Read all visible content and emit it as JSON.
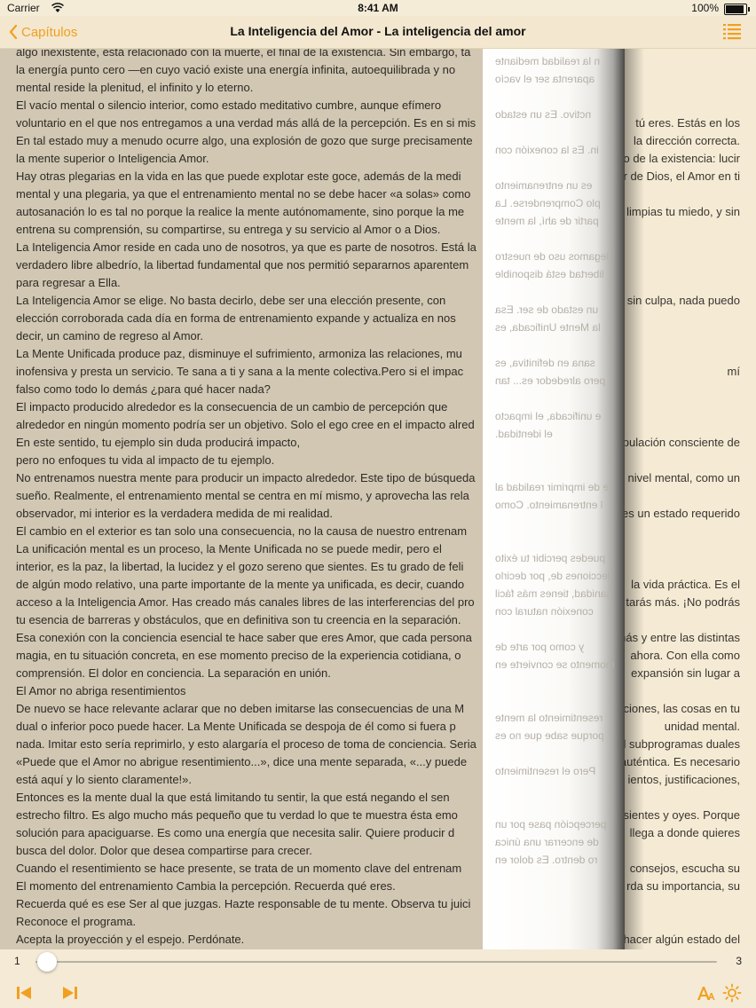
{
  "status_bar": {
    "carrier": "Carrier",
    "time": "8:41 AM",
    "battery": "100%"
  },
  "navbar": {
    "back_label": "Capítulos",
    "title": "La Inteligencia del Amor - La inteligencia del amor"
  },
  "paragraphs": [
    "algo inexistente, está relacionado con la muerte, el final de la existencia. Sin embargo, tan solo se trata de una falta de realidad mediante la energía punto cero —en cuyo vació existe una energía infinita, autoequilibrada y no ... aparenta ser el vacío mental reside la plenitud, el infinito y lo eterno.",
    "El vacío mental o silencio interior, como estado meditativo cumbre, aunque efímero, es ... Es un estado voluntario en el que nos entregamos a una verdad más allá de la percepción. Es en si mismo ... tú eres. Estás en los",
    "En tal estado muy a menudo ocurre algo, una explosión de gozo que surge precisamente ... Es la conexión con la dirección correcta.",
    "la mente superior o Inteligencia Amor. ... lo de la existencia: lucir",
    "Hay otras plegarias en la vida en las que puede explotar este goce, además de la medi... es un entrenamiento ... r de Dios, el Amor en ti mental y una plegaria, ya que el entrenamiento mental no se debe hacer «a solas» como ... La autosanación lo es tal no porque la realice la mente autónomamente, sino porque la me... limpias tu miedo, y sin entrena su comprensión, su compartirse, su entrega y su servicio al Amor o a Dios.",
    "La Inteligencia Amor reside en cada uno de nosotros, ya que es parte de nosotros. Está la ... verdadero libre albedrío, la libertad fundamental que nos permitió separarnos aparentem... para regresar a Ella.",
    "La Inteligencia Amor se elige. No basta decirlo, debe ser una elección presente, con... sin culpa, nada puedo elección corroborada cada día en forma de entrenamiento expande y actualiza en nos... decir, un camino de regreso al Amor.",
    "La Mente Unificada produce paz, disminuye el sufrimiento, armoniza las relaciones, mu... inofensiva y presta un servicio. Te sana a ti y sana a la mente colectiva.Pero si el impac... mí falso como todo lo demás ¿para qué hacer nada?",
    "El impacto producido alrededor es la consecuencia de un cambio de percepción que ... alrededor en ningún momento podría ser un objetivo. Solo el ego cree en el impacto alred...",
    "En este sentido, tu ejemplo sin duda producirá impacto, ... pulación consciente de",
    "pero no enfoques tu vida al impacto de tu ejemplo.",
    "No entrenamos nuestra mente para producir un impacto alrededor. Este tipo de búsqueda ... nivel mental, como un sueño. Realmente, el entrenamiento mental se centra en mí mismo, y aprovecha las rela... observador, mi interior es la verdadera medida de mi realidad. ... es un estado requerido",
    "El cambio en el exterior es tan solo una consecuencia, no la causa de nuestro entrenam...",
    "La unificación mental es un proceso, la Mente Unificada no se puede medir, pero el ... interior, es la paz, la libertad, la lucidez y el gozo sereno que sientes. Es tu grado de feli... de algún modo relativo, una parte importante de la mente ya unificada, es decir, cuando ... la vida práctica. Es el acceso a la Inteligencia Amor. Has creado más canales libres de las interferencias del pro... tarás más. ¡No podrás tu esencia de barreras y obstáculos, que en definitiva son tu creencia en la separación.",
    "Esa conexión con la conciencia esencial te hace saber que eres Amor, que cada persona... más y entre las distintas magia, en tu situación concreta, en ese momento preciso de la experiencia cotidiana, o... ahora. Con ella como comprensión. El dolor en conciencia. La separación en unión. ... expansión sin lugar a",
    "El Amor no abriga resentimientos",
    "De nuevo se hace relevante aclarar que no deben imitarse las consecuencias de una M... ciones, las cosas en tu dual o inferior poco puede hacer. La Mente Unificada se despoja de él como si fuera p... unidad mental. nada. Imitar esto sería reprimirlo, y esto alargaría el proceso de toma de conciencia. Seria ... il subprogramas duales «Puede que el Amor no abrigue resentimiento...», dice una mente separada, «...y puede ... auténtica. Es necesario está aquí y lo siento claramente!». ... ientos, justificaciones,",
    "Entonces es la mente dual la que está limitando tu sentir, la que está negando el sen... estrecho filtro. Es algo mucho más pequeño que tu verdad lo que te muestra ésta emo... sientes y oyes. Porque solución para apaciguarse. Es como una energía que necesita salir. Quiere producir d... llega a donde quieres busca del dolor. Dolor que desea compartirse para crecer.",
    "Cuando el resentimiento se hace presente, se trata de un momento clave del entrenam... consejos, escucha su El momento del entrenamiento Cambia la percepción. Recuerda qué eres. ... rda su importancia, su",
    "Recuerda qué es ese Ser al que juzgas. Hazte responsable de tu mente. Observa tu juici... Reconoce el programa.",
    "Acepta la proyección y el espejo. Perdónate. ... hacer algún estado del"
  ],
  "left_lines": [
    "algo inexistente, está relacionado con la muerte, el final de la existencia. Sin embargo, ta",
    "la energía punto cero —en cuyo vació existe una energía infinita, autoequilibrada y no",
    "mental reside la plenitud, el infinito y lo eterno.",
    "El vacío mental o silencio interior, como estado meditativo cumbre, aunque efímero",
    "voluntario en el que nos entregamos a una verdad más allá de la percepción. Es en si mis",
    "En tal estado muy a menudo ocurre algo, una explosión de gozo que surge precisamente",
    "la mente superior o Inteligencia Amor.",
    "Hay otras plegarias en la vida en las que puede explotar este goce, además de la medi",
    "mental y una plegaria, ya que el entrenamiento mental no se debe hacer «a solas» como",
    "autosanación lo es tal no porque la realice la mente autónomamente, sino porque la me",
    "entrena su comprensión, su compartirse, su entrega y su servicio al Amor o a Dios.",
    "La Inteligencia Amor reside en cada uno de nosotros, ya que es parte de nosotros. Está la",
    "verdadero libre albedrío, la libertad fundamental que nos permitió separarnos aparentem",
    "para regresar a Ella.",
    "La Inteligencia Amor se elige. No basta decirlo, debe ser una elección presente, con",
    "elección corroborada cada día en forma de entrenamiento expande y actualiza en nos",
    "decir, un camino de regreso al Amor.",
    "La Mente Unificada produce paz, disminuye el sufrimiento, armoniza las relaciones, mu",
    "inofensiva y presta un servicio. Te sana a ti y sana a la mente colectiva.Pero si el impac",
    "falso como todo lo demás ¿para qué hacer nada?",
    "El impacto producido alrededor es la consecuencia de un cambio de percepción que",
    "alrededor en ningún momento podría ser un objetivo. Solo el ego cree en el impacto alred",
    "En este sentido, tu ejemplo sin duda producirá impacto,",
    "pero no enfoques tu vida al impacto de tu ejemplo.",
    "No entrenamos nuestra mente para producir un impacto alrededor. Este tipo de búsqueda",
    "sueño. Realmente, el entrenamiento mental se centra en mí mismo, y aprovecha las rela",
    "observador, mi interior es la verdadera medida de mi realidad.",
    "El cambio en el exterior es tan solo una consecuencia, no la causa de nuestro entrenam",
    "La unificación mental es un proceso, la Mente Unificada no se puede medir, pero el",
    "interior, es la paz, la libertad, la lucidez y el gozo sereno que sientes. Es tu grado de feli",
    "de algún modo relativo, una parte importante de la mente ya unificada, es decir, cuando",
    "acceso a la Inteligencia Amor. Has creado más canales libres de las interferencias del pro",
    "tu esencia de barreras y obstáculos, que en definitiva son tu creencia en la separación.",
    "Esa conexión con la conciencia esencial te hace saber que eres Amor, que cada persona",
    "magia, en tu situación concreta, en ese momento preciso de la experiencia cotidiana, o",
    "comprensión. El dolor en conciencia. La separación en unión.",
    "El Amor no abriga resentimientos",
    "De nuevo se hace relevante aclarar que no deben imitarse las consecuencias de una M",
    "dual o inferior poco puede hacer. La Mente Unificada se despoja de él como si fuera p",
    "nada. Imitar esto sería reprimirlo, y esto alargaría el proceso de toma de conciencia. Seria",
    "«Puede que el Amor no abrigue resentimiento...», dice una mente separada, «...y puede",
    "está aquí y lo siento claramente!».",
    "Entonces es la mente dual la que está limitando tu sentir, la que está negando el sen",
    "estrecho filtro. Es algo mucho más pequeño que tu verdad lo que te muestra ésta emo",
    "solución para apaciguarse. Es como una energía que necesita salir. Quiere producir d",
    "busca del dolor. Dolor que desea compartirse para crecer.",
    "Cuando el resentimiento se hace presente, se trata de un momento clave del entrenam",
    "El momento del entrenamiento Cambia la percepción. Recuerda qué eres.",
    "Recuerda qué es ese Ser al que juzgas. Hazte responsable de tu mente. Observa tu juici",
    "Reconoce el programa.",
    "Acepta la proyección y el espejo. Perdónate."
  ],
  "right_lines": [
    "",
    "",
    "",
    "",
    "tú eres. Estás en los",
    "la dirección correcta.",
    "lo de la existencia: lucir",
    "r de Dios, el Amor en ti",
    "",
    "limpias tu miedo, y sin",
    "",
    "",
    "",
    "",
    "sin culpa, nada puedo",
    "",
    "",
    "",
    "mí",
    "",
    "",
    "",
    "pulación consciente de",
    "",
    "nivel mental, como un",
    "",
    "es un estado requerido",
    "",
    "",
    "",
    "la vida práctica. Es el",
    "tarás más. ¡No podrás",
    "",
    "más y entre las distintas",
    "ahora. Con ella como",
    "expansión sin lugar a",
    "",
    "ciones, las cosas en tu",
    "unidad mental.",
    "il subprogramas duales",
    "auténtica. Es necesario",
    "ientos, justificaciones,",
    "",
    "sientes y oyes. Porque",
    "llega a donde quieres",
    "",
    "consejos, escucha su",
    "rda su importancia, su",
    "",
    "",
    "hacer algún estado del"
  ],
  "curl_lines": [
    "n la realidad mediante",
    "aparenta ser el vacío",
    "",
    "nctivo. Es un estado",
    "",
    "in. Es la conexión con",
    "",
    "es un entrenamiento",
    "plo Comprenderse. La",
    "partir de ahí, la mente",
    "",
    "legamos uso de nuestro",
    "libertad está disponible",
    "",
    "un estado de ser. Esa",
    "la Mente Unificada, es",
    "",
    "sana en definitiva, es",
    "pero alrededor es... tan",
    "",
    "e unificada, el impacto",
    "el identidad.",
    "",
    "",
    "e de imprimir realidad al",
    "l entrenamiento. Como",
    "",
    "",
    "puedes percibir tu éxito",
    "lecciones de, por decirlo",
    "sanidad, tienes más fácil",
    "conexión natural con",
    "",
    "y como por arte de",
    "momento se convierte en",
    "",
    "",
    "resentimiento la mente",
    "porque sabe que no es",
    "",
    "Pero el resentimiento",
    "",
    "",
    "percepción pase por un",
    "de encerrar una única",
    "ro dentro. Es dolor en"
  ],
  "reader": {
    "page_start": "1",
    "page_end": "3",
    "progress_fraction": 0.0
  }
}
